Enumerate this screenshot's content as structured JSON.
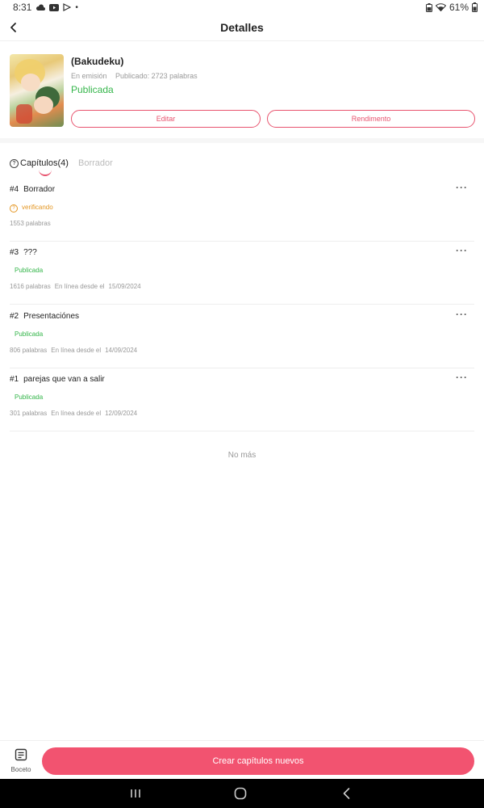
{
  "statusbar": {
    "time": "8:31",
    "battery": "61%"
  },
  "header": {
    "title": "Detalles"
  },
  "book": {
    "title": "(Bakudeku)",
    "state": "En emisión",
    "published_words": "Publicado: 2723 palabras",
    "status": "Publicada",
    "edit_label": "Editar",
    "performance_label": "Rendimento"
  },
  "tabs": {
    "chapters": "Capítulos(4)",
    "drafts": "Borrador"
  },
  "chapters": [
    {
      "num": "#4",
      "title": "Borrador",
      "status": "verificando",
      "words": "1553 palabras",
      "online": "",
      "date": ""
    },
    {
      "num": "#3",
      "title": "???",
      "status": "Publicada",
      "words": "1616 palabras",
      "online": "En línea desde el",
      "date": "15/09/2024"
    },
    {
      "num": "#2",
      "title": "Presentaciónes",
      "status": "Publicada",
      "words": "806 palabras",
      "online": "En línea desde el",
      "date": "14/09/2024"
    },
    {
      "num": "#1",
      "title": "parejas que van a salir",
      "status": "Publicada",
      "words": "301 palabras",
      "online": "En línea desde el",
      "date": "12/09/2024"
    }
  ],
  "more_glyph": "···",
  "list_end": "No más",
  "bottom": {
    "draft_label": "Boceto",
    "create_label": "Crear capítulos nuevos"
  },
  "colors": {
    "accent": "#f25370",
    "published": "#35b64b",
    "verifying": "#e49622"
  }
}
